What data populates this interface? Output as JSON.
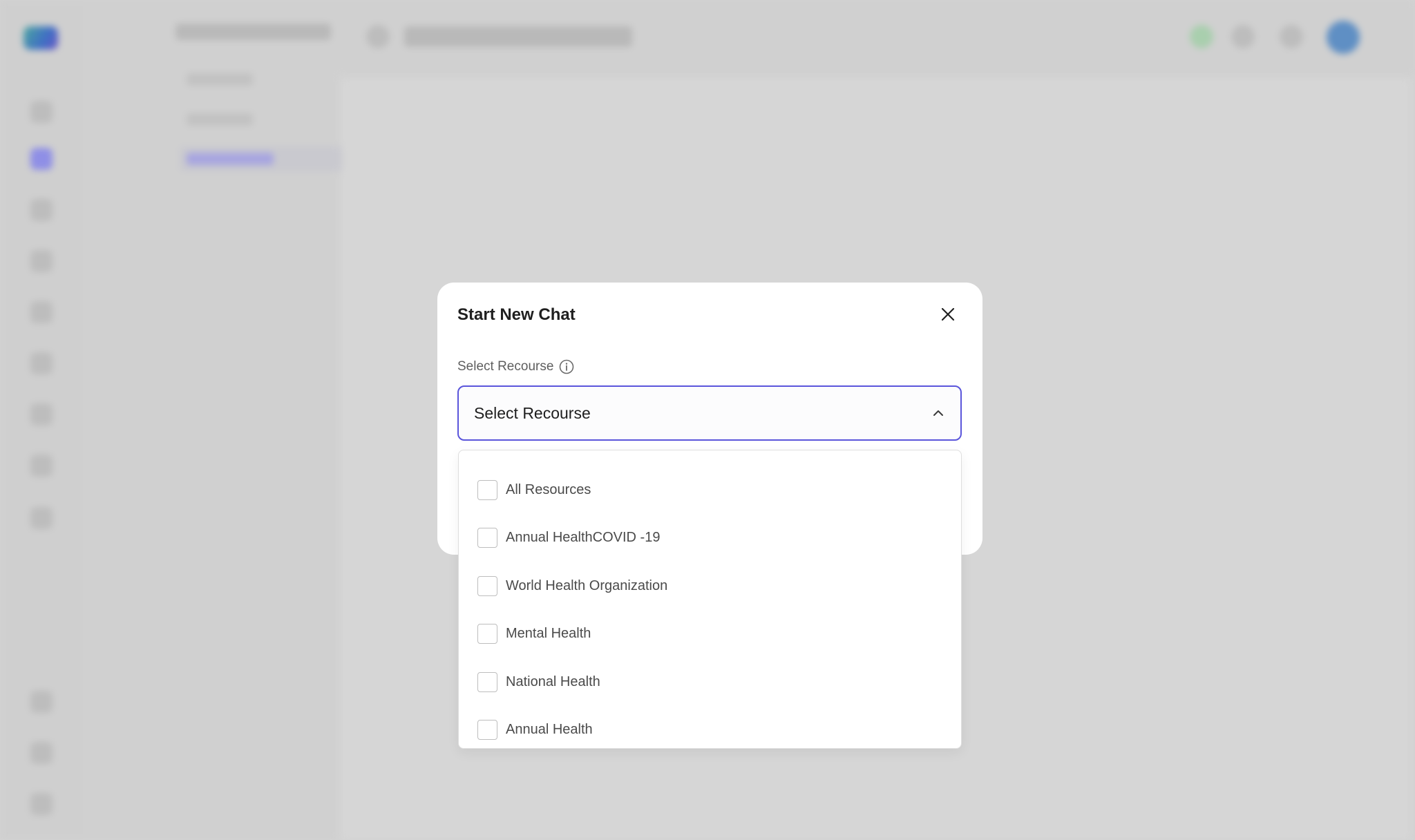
{
  "modal": {
    "title": "Start New Chat",
    "field_label": "Select Recourse",
    "select_value": "Select Recourse"
  },
  "dropdown": {
    "options": [
      {
        "label": "All Resources",
        "checked": false
      },
      {
        "label": "Annual HealthCOVID -19",
        "checked": false
      },
      {
        "label": "World Health Organization",
        "checked": false
      },
      {
        "label": "Mental Health",
        "checked": false
      },
      {
        "label": "National Health",
        "checked": false
      },
      {
        "label": "Annual Health",
        "checked": false
      }
    ]
  },
  "colors": {
    "accent": "#5a55db",
    "overlay": "#d3d3d3",
    "modal_bg": "#ffffff"
  },
  "icons": {
    "close": "close-icon",
    "info": "info-icon",
    "chevron": "chevron-up-icon"
  }
}
